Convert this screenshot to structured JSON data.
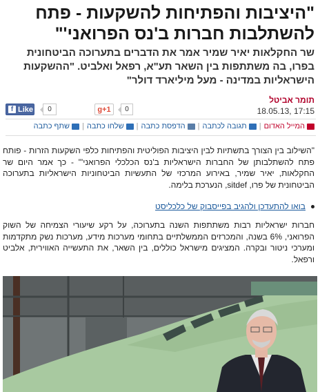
{
  "article": {
    "headline": "\"היציבות והפתיחות להשקעות - פתח להשתלבות חברות ב'נס הפרואני'\"",
    "subhead": "שר החקלאות יאיר שמיר אמר את הדברים בתערוכה הביטחונית בפרו, בה משתתפות בין השאר תע\"א, רפאל ואלביט. \"ההשקעות הישראליות במדינה - מעל מיליארד דולר\"",
    "author": "תומר אביטל",
    "date": "17:15 ,18.05.13",
    "paragraph1": "\"השילוב בין הצורך בתשתיות לבין היציבות הפוליטית והפתיחות כלפי השקעות הזרות - פותח פתח להשתלבותן של החברות הישראליות ב'נס הכלכלי הפרואני'\" - כך אמר היום שר החקלאות, יאיר שמיר, באירוע המרכזי של התעשיות הביטחוניות הישראליות בתערוכה הביטחונית של פרו, sitdef, הנערכת בלימה.",
    "bullet_link": "בואו להתעדכן ולהגיב בפייסבוק של כלכליסט",
    "paragraph2": "חברות ישראליות רבות משתתפות השנה בתערוכה, על רקע שיעורי הצמיחה של השוק הפרואני, 6% בשנה, והמכרזים הממשלתיים בתחומי מערכות מידע, מערכות נשק מתקדמות ומערכי ניטור ובקרה. המציגים מישראל כוללים, בין השאר, את התעשייה האווירית, אלביט ורפאל."
  },
  "social": {
    "fb_like_label": "Like",
    "fb_icon_glyph": "f",
    "fb_count": "0",
    "gplus_label": "g+1",
    "gplus_count": "0"
  },
  "toolbar": {
    "items": [
      {
        "label": "המייל האדום",
        "icon": "red-mail-icon",
        "color": "#c0002a"
      },
      {
        "label": "תגובה לכתבה",
        "icon": "comment-icon",
        "color": "#1c5a9c"
      },
      {
        "label": "הדפסת כתבה",
        "icon": "print-icon",
        "color": "#1c5a9c"
      },
      {
        "label": "שלחו כתבה",
        "icon": "mail-icon",
        "color": "#1c5a9c"
      },
      {
        "label": "שתף כתבה",
        "icon": "share-icon",
        "color": "#1c5a9c"
      }
    ]
  },
  "colors": {
    "author": "#b0002a",
    "link": "#1c5a9c",
    "facebook": "#4b67a1",
    "gplus": "#dd4b39"
  }
}
